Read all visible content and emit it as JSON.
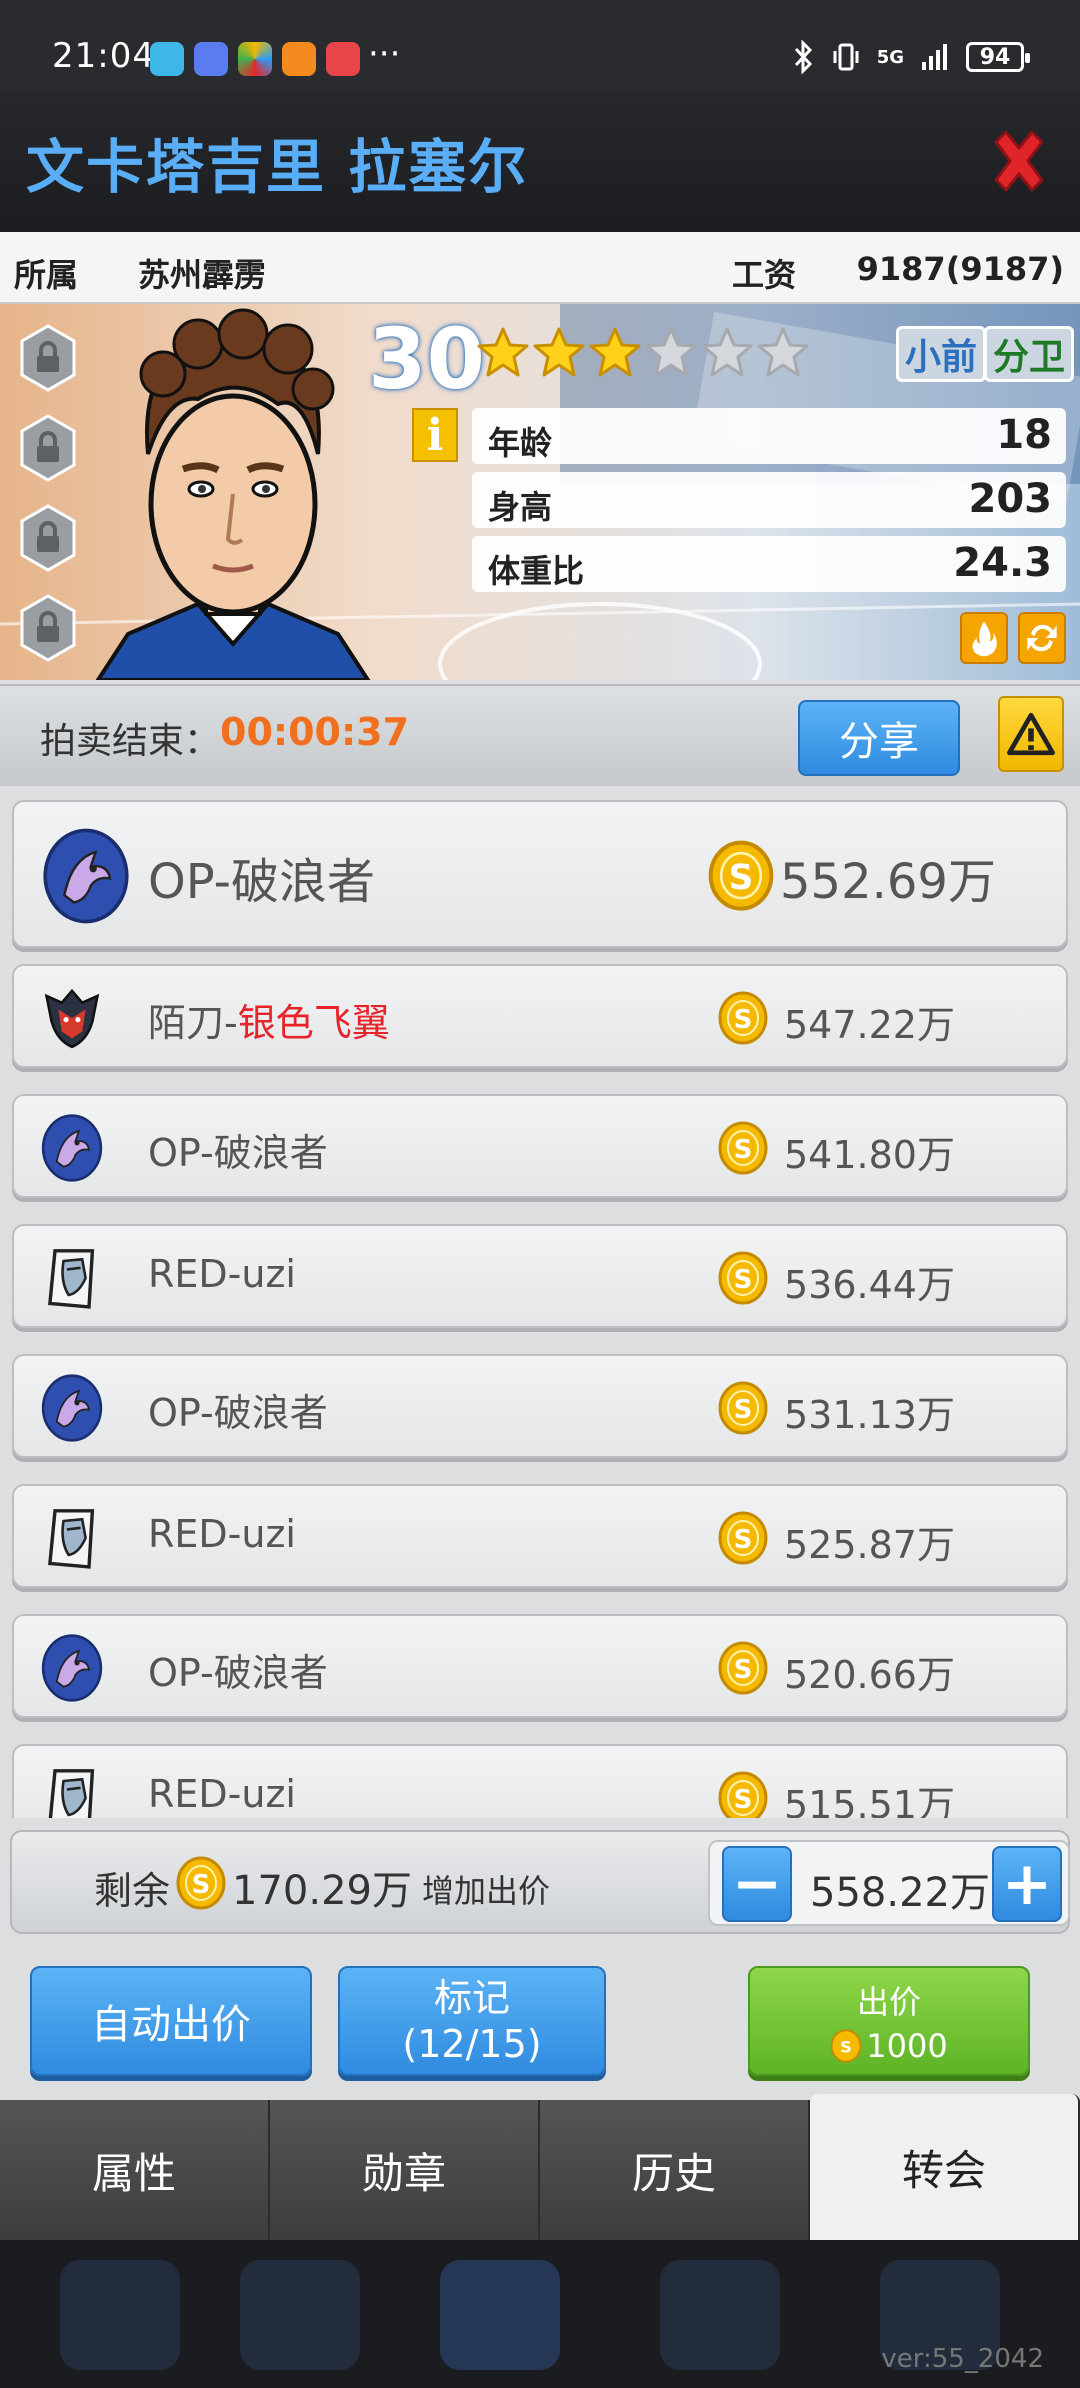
{
  "status_bar": {
    "time": "21:04",
    "more": "···",
    "signal": "5G",
    "battery": "94"
  },
  "header": {
    "player_name": "文卡塔吉里 拉塞尔"
  },
  "info_row": {
    "team_label": "所属",
    "team_value": "苏州霹雳",
    "salary_label": "工资",
    "salary_value": "9187(9187)"
  },
  "player": {
    "rating": "30",
    "stars_filled": 3,
    "stars_total": 6,
    "positions": [
      "小前",
      "分卫"
    ],
    "info_icon": "i",
    "stats": [
      {
        "label": "年龄",
        "value": "18"
      },
      {
        "label": "身高",
        "value": "203"
      },
      {
        "label": "体重比",
        "value": "24.3"
      }
    ]
  },
  "auction": {
    "label": "拍卖结束：",
    "timer": "00:00:37",
    "share_label": "分享"
  },
  "bids": [
    {
      "team": "OP",
      "bidder": "破浪者",
      "highlight": "",
      "amount": "552.69万",
      "logo": "op-logo"
    },
    {
      "team": "陌刀",
      "bidder": "",
      "highlight": "银色飞翼",
      "amount": "547.22万",
      "logo": "modao-logo"
    },
    {
      "team": "OP",
      "bidder": "破浪者",
      "highlight": "",
      "amount": "541.80万",
      "logo": "op-logo"
    },
    {
      "team": "RED",
      "bidder": "uzi",
      "highlight": "",
      "amount": "536.44万",
      "logo": "red-logo"
    },
    {
      "team": "OP",
      "bidder": "破浪者",
      "highlight": "",
      "amount": "531.13万",
      "logo": "op-logo"
    },
    {
      "team": "RED",
      "bidder": "uzi",
      "highlight": "",
      "amount": "525.87万",
      "logo": "red-logo"
    },
    {
      "team": "OP",
      "bidder": "破浪者",
      "highlight": "",
      "amount": "520.66万",
      "logo": "op-logo"
    },
    {
      "team": "RED",
      "bidder": "uzi",
      "highlight": "",
      "amount": "515.51万",
      "logo": "red-logo"
    }
  ],
  "bottom": {
    "remain_label": "剩余",
    "remain_value": "170.29万",
    "increase_label": "增加出价",
    "bid_value": "558.22万",
    "auto_bid": "自动出价",
    "mark_label": "标记",
    "mark_count": "(12/15)",
    "bid_button": "出价",
    "bid_cost": "1000"
  },
  "tabs": [
    "属性",
    "勋章",
    "历史",
    "转会"
  ],
  "active_tab": 3,
  "footer": {
    "version": "ver:55_2042"
  },
  "colors": {
    "accent_blue": "#3c9ced",
    "timer_orange": "#f07020",
    "highlight_red": "#e8232a",
    "bid_green": "#6cc02f",
    "title_blue": "#5aaef7"
  }
}
